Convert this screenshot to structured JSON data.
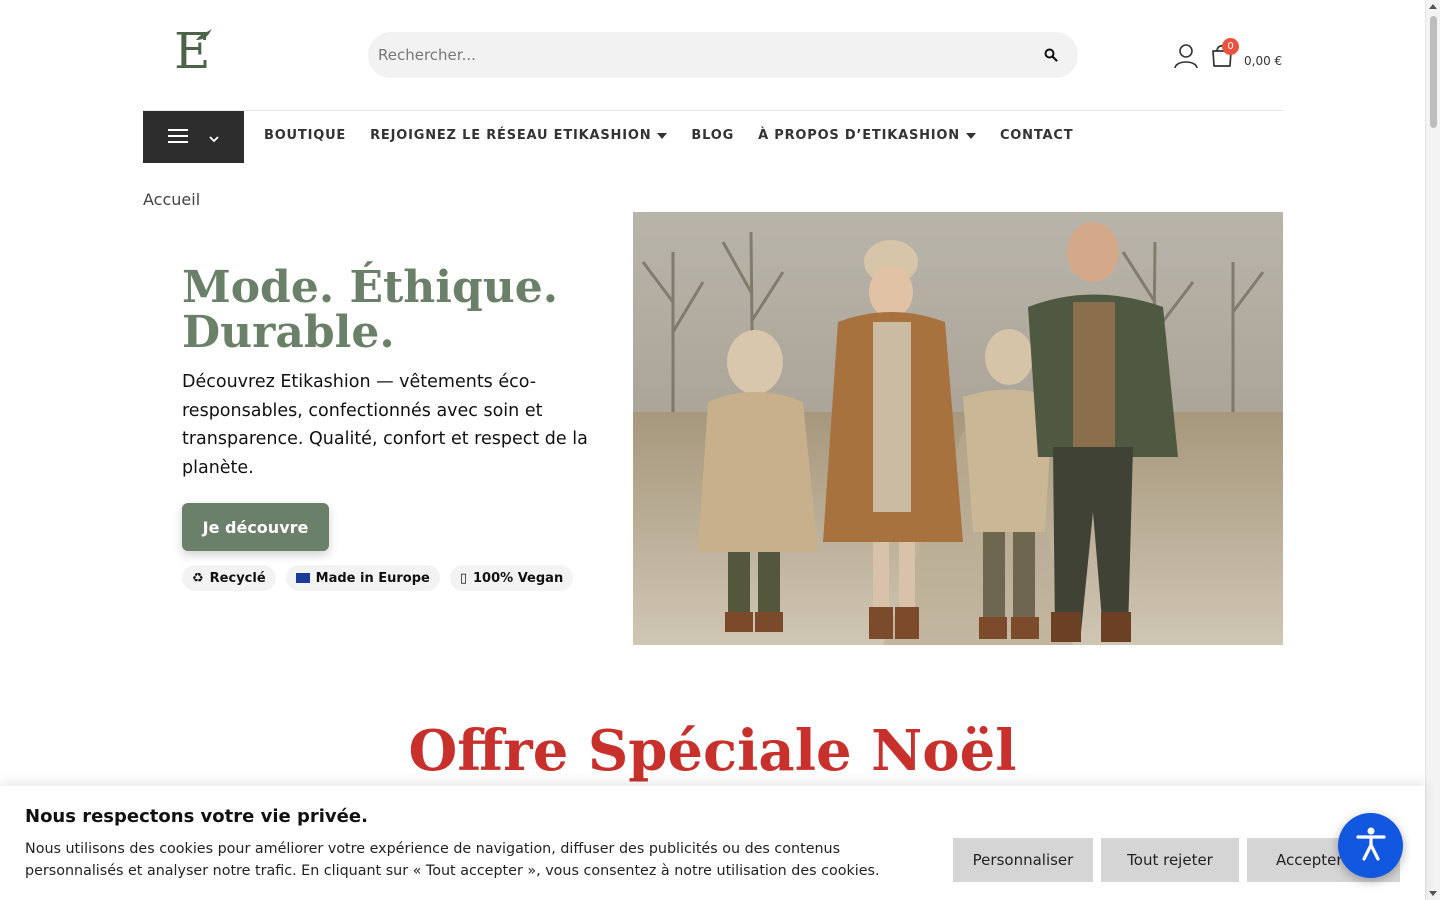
{
  "header": {
    "logo_letter": "E",
    "search_placeholder": "Rechercher...",
    "cart_count": "0",
    "cart_total": "0,00 €"
  },
  "nav": {
    "items": [
      {
        "label": "BOUTIQUE"
      },
      {
        "label": "REJOIGNEZ LE RÉSEAU ETIKASHION"
      },
      {
        "label": "BLOG"
      },
      {
        "label": "À PROPOS D’ETIKASHION"
      },
      {
        "label": "CONTACT"
      }
    ]
  },
  "breadcrumb": "Accueil",
  "hero": {
    "title": "Mode. Éthique. Durable.",
    "description": "Découvrez Etikashion — vêtements éco-responsables, confectionnés avec soin et transparence. Qualité, confort et respect de la planète.",
    "cta_label": "Je découvre",
    "tags": [
      {
        "icon": "recycle-icon",
        "symbol": "♻",
        "label": "Recyclé"
      },
      {
        "icon": "eu-flag-icon",
        "label": "Made in Europe"
      },
      {
        "icon": "leaf-icon",
        "symbol": "▯",
        "label": "100% Vegan"
      }
    ]
  },
  "section": {
    "title_regular": "Offre Spéciale",
    "title_bold": "Noël"
  },
  "cookie": {
    "title": "Nous respectons votre vie privée.",
    "text": "Nous utilisons des cookies pour améliorer votre expérience de navigation, diffuser des publicités ou des contenus personnalisés et analyser notre trafic. En cliquant sur « Tout accepter », vous consentez à notre utilisation des cookies.",
    "customize_label": "Personnaliser",
    "reject_label": "Tout rejeter",
    "accept_label": "Accepter"
  },
  "colors": {
    "brand_green": "#6b8068",
    "christmas_red": "#c8302b",
    "nav_dark": "#2d2d2d",
    "badge_red": "#e9533f",
    "a11y_blue": "#1257e0"
  }
}
